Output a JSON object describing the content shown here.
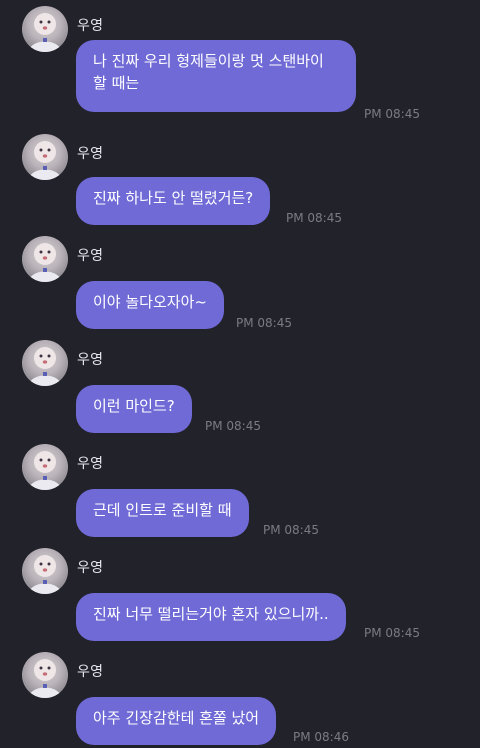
{
  "chat": {
    "messages": [
      {
        "sender": "우영",
        "lines": [
          "나 진짜 우리 형제들이랑 멋 스탠바이",
          "할 때는"
        ],
        "time": "PM 08:45"
      },
      {
        "sender": "우영",
        "lines": [
          "진짜 하나도 안 떨렸거든?"
        ],
        "time": "PM 08:45"
      },
      {
        "sender": "우영",
        "lines": [
          "이야 놀다오자아~"
        ],
        "time": "PM 08:45"
      },
      {
        "sender": "우영",
        "lines": [
          "이런 마인드?"
        ],
        "time": "PM 08:45"
      },
      {
        "sender": "우영",
        "lines": [
          "근데 인트로 준비할 때"
        ],
        "time": "PM 08:45"
      },
      {
        "sender": "우영",
        "lines": [
          "진짜 너무 떨리는거야 혼자 있으니까.."
        ],
        "time": "PM 08:45"
      },
      {
        "sender": "우영",
        "lines": [
          "아주 긴장감한테 혼쫄 났어"
        ],
        "time": "PM 08:46"
      }
    ]
  },
  "colors": {
    "background": "#22222a",
    "bubble": "#6f6ad6",
    "bubble_text": "#ffffff",
    "name_text": "#e7e7ef",
    "time_text": "#7b7b86"
  },
  "icons": {
    "avatar": "profile-avatar-icon"
  }
}
